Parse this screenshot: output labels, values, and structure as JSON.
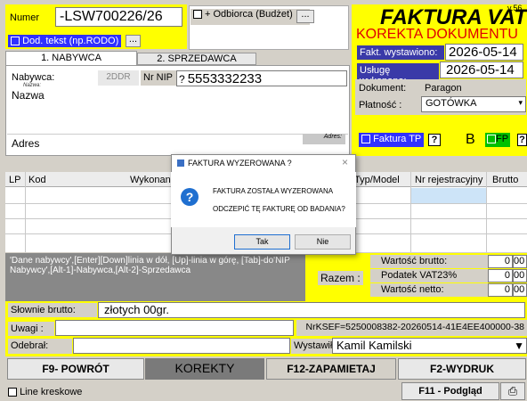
{
  "top": {
    "numer_label": "Numer",
    "numer_value": "-LSW700226/26",
    "dod_tekst_label": "Dod. tekst (np.RODO)",
    "dots": "...",
    "odbiorca_label": "+ Odbiorca (Budżet)",
    "title": "FAKTURA VAT",
    "version": "v.56",
    "korekta": "KOREKTA DOKUMENTU"
  },
  "tabs": [
    "1. NABYWCA",
    "2. SPRZEDAWCA"
  ],
  "nabywca": {
    "label": "Nabywca:",
    "small_label": "Nazwa:",
    "ddr": "2DDR",
    "nip_label": "Nr NIP",
    "nip_q": "?",
    "nip_value": "5553332233",
    "nazwa": "Nazwa",
    "adres": "Adres",
    "adres_hint": "Adres:"
  },
  "right_panel": {
    "fakt_wystawiono_label": "Fakt. wystawiono:",
    "fakt_wystawiono_value": "2026-05-14",
    "usluge_label": "Usługę wykonano:",
    "usluge_value": "2026-05-14",
    "dokument_label": "Dokument:",
    "dokument_value": "Paragon",
    "platnosc_label": "Płatność :",
    "platnosc_value": "GOTÓWKA",
    "faktura_tp_label": "Faktura TP",
    "q": "?",
    "b_label": "B",
    "fp_label": "FP"
  },
  "table": {
    "columns": [
      "LP",
      "Kod",
      "Wykonana",
      "Typ/Model",
      "Nr rejestracyjny",
      "Brutto"
    ]
  },
  "hint": "'Dane nabywcy',[Enter][Down]linia w dół, [Up]-linia w górę, [Tab]-do'NIP Nabywcy',[Alt-1]-Nabywca,[Alt-2]-Sprzedawca",
  "totals": {
    "razem_label": "Razem :",
    "wartosc_brutto_label": "Wartość brutto:",
    "wartosc_brutto_value": "0",
    "wartosc_brutto_gr": "00",
    "podatek_label": "Podatek VAT23%",
    "podatek_value": "0",
    "podatek_gr": "00",
    "wartosc_netto_label": "Wartość netto:",
    "wartosc_netto_value": "0",
    "wartosc_netto_gr": "00"
  },
  "slownie": {
    "label": "Słownie brutto:",
    "value": "złotych  00gr."
  },
  "uwagi": {
    "label": "Uwagi :",
    "ksef": "NrKSEF=5250008382-20260514-41E4EE400000-38"
  },
  "odebral": {
    "label": "Odebrał:",
    "wystawil_label": "Wystawił:",
    "wystawil_value": "Kamil Kamilski"
  },
  "buttons": {
    "f9": "F9- POWRÓT",
    "korekty": "KOREKTY",
    "f12": "F12-ZAPAMIETAJ",
    "f2": "F2-WYDRUK",
    "f11": "F11 - Podgląd",
    "line_kreskowe": "Line kreskowe"
  },
  "dialog": {
    "title": "FAKTURA WYZEROWANA ?",
    "line1": "FAKTURA ZOSTAŁA WYZEROWANA",
    "line2": "ODCZEPIĆ TĘ FAKTURĘ OD BADANIA?",
    "tak": "Tak",
    "nie": "Nie",
    "close": "×",
    "question": "?"
  }
}
